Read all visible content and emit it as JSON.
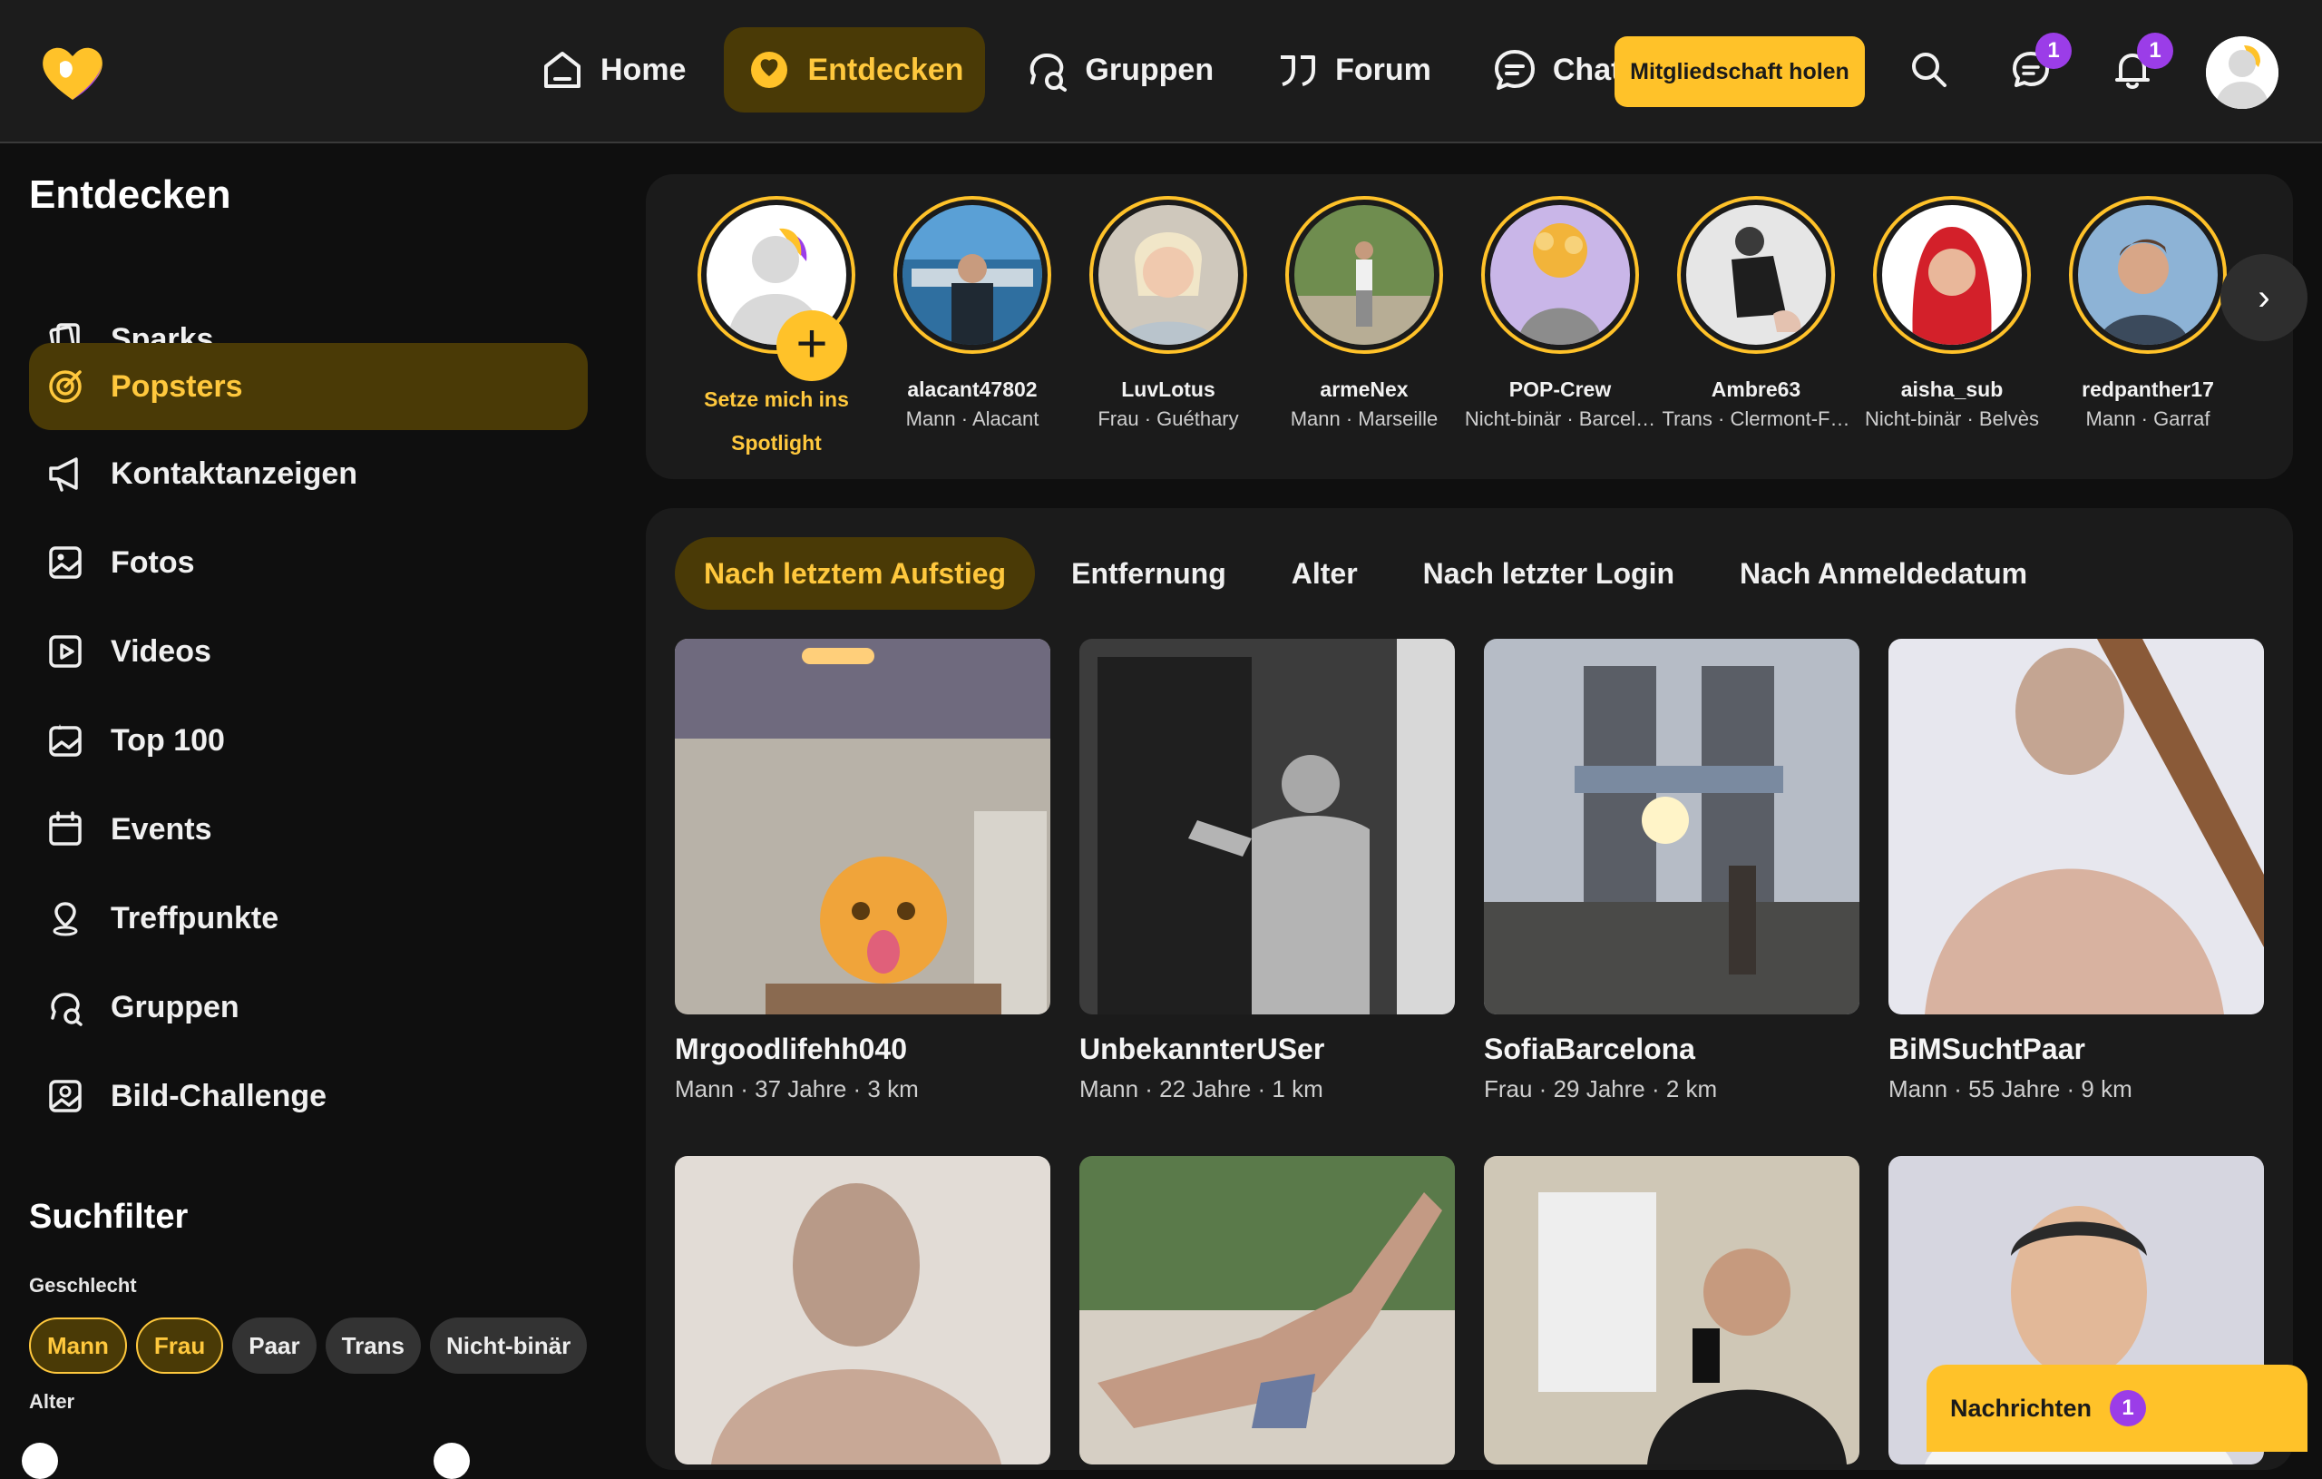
{
  "nav": {
    "items": [
      {
        "label": "Home",
        "icon": "home-icon"
      },
      {
        "label": "Entdecken",
        "icon": "discover-icon",
        "active": true
      },
      {
        "label": "Gruppen",
        "icon": "groups-icon"
      },
      {
        "label": "Forum",
        "icon": "quote-icon"
      },
      {
        "label": "Chat",
        "icon": "chat-icon"
      }
    ],
    "cta_label": "Mitgliedschaft holen",
    "messages_badge": "1",
    "notifications_badge": "1"
  },
  "sidebar": {
    "title": "Entdecken",
    "items": [
      {
        "label": "Sparks",
        "icon": "cards-icon"
      },
      {
        "label": "Popsters",
        "icon": "target-icon",
        "active": true
      },
      {
        "label": "Kontaktanzeigen",
        "icon": "megaphone-icon"
      },
      {
        "label": "Fotos",
        "icon": "photo-icon"
      },
      {
        "label": "Videos",
        "icon": "video-icon"
      },
      {
        "label": "Top 100",
        "icon": "top-photo-icon"
      },
      {
        "label": "Events",
        "icon": "calendar-icon"
      },
      {
        "label": "Treffpunkte",
        "icon": "map-pin-icon"
      },
      {
        "label": "Gruppen",
        "icon": "groups-icon"
      },
      {
        "label": "Bild-Challenge",
        "icon": "image-challenge-icon"
      }
    ],
    "filter_title": "Suchfilter",
    "gender_label": "Geschlecht",
    "genders": [
      {
        "label": "Mann",
        "selected": true
      },
      {
        "label": "Frau",
        "selected": true
      },
      {
        "label": "Paar",
        "selected": false
      },
      {
        "label": "Trans",
        "selected": false
      },
      {
        "label": "Nicht-binär",
        "selected": false
      }
    ],
    "age_label": "Alter"
  },
  "stories": {
    "self_label_line1": "Setze mich ins",
    "self_label_line2": "Spotlight",
    "items": [
      {
        "name": "alacant47802",
        "meta": "Mann · Alacant"
      },
      {
        "name": "LuvLotus",
        "meta": "Frau · Guéthary"
      },
      {
        "name": "armeNex",
        "meta": "Mann · Marseille"
      },
      {
        "name": "POP-Crew",
        "meta": "Nicht-binär · Barcel…"
      },
      {
        "name": "Ambre63",
        "meta": "Trans · Clermont-F…"
      },
      {
        "name": "aisha_sub",
        "meta": "Nicht-binär · Belvès"
      },
      {
        "name": "redpanther17",
        "meta": "Mann · Garraf"
      }
    ]
  },
  "sort_tabs": [
    {
      "label": "Nach letztem Aufstieg",
      "active": true
    },
    {
      "label": "Entfernung"
    },
    {
      "label": "Alter"
    },
    {
      "label": "Nach letzter Login"
    },
    {
      "label": "Nach Anmeldedatum"
    }
  ],
  "profiles": [
    {
      "name": "Mrgoodlifehh040",
      "meta": "Mann · 37 Jahre · 3 km"
    },
    {
      "name": "UnbekannterUSer",
      "meta": "Mann · 22 Jahre · 1 km"
    },
    {
      "name": "SofiaBarcelona",
      "meta": "Frau · 29 Jahre · 2 km"
    },
    {
      "name": "BiMSuchtPaar",
      "meta": "Mann · 55 Jahre · 9 km"
    }
  ],
  "messages_pill": {
    "label": "Nachrichten",
    "count": "1"
  },
  "colors": {
    "accent": "#ffc229",
    "accent_bg": "#4a3a06",
    "badge": "#9b3de8"
  }
}
